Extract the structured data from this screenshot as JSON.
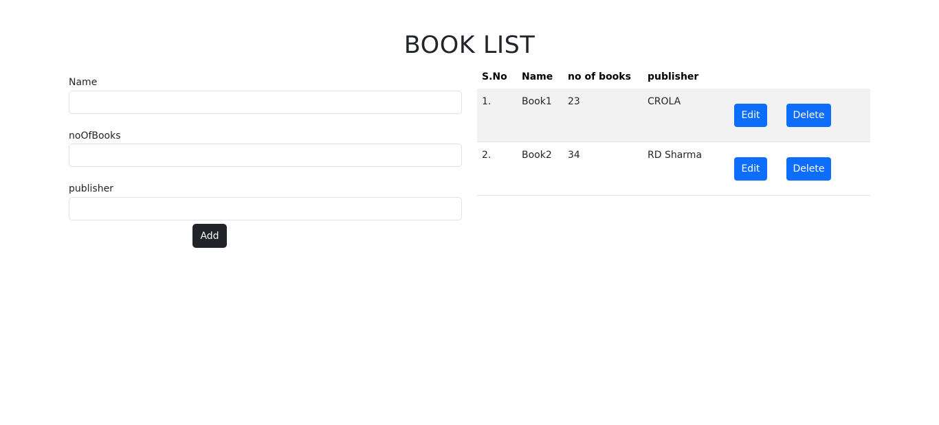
{
  "page": {
    "title": "BOOK LIST"
  },
  "form": {
    "name_label": "Name",
    "name_value": "",
    "books_label": "noOfBooks",
    "books_value": "",
    "publisher_label": "publisher",
    "publisher_value": "",
    "add_label": "Add"
  },
  "table": {
    "headers": [
      "S.No",
      "Name",
      "no of books",
      "publisher"
    ],
    "rows": [
      {
        "sno": "1.",
        "name": "Book1",
        "books": "23",
        "publisher": "CROLA",
        "edit": "Edit",
        "delete": "Delete"
      },
      {
        "sno": "2.",
        "name": "Book2",
        "books": "34",
        "publisher": "RD Sharma",
        "edit": "Edit",
        "delete": "Delete"
      }
    ]
  },
  "colors": {
    "primary_button": "#0d6efd",
    "dark_button": "#212529",
    "striped_row": "#f2f2f2"
  }
}
